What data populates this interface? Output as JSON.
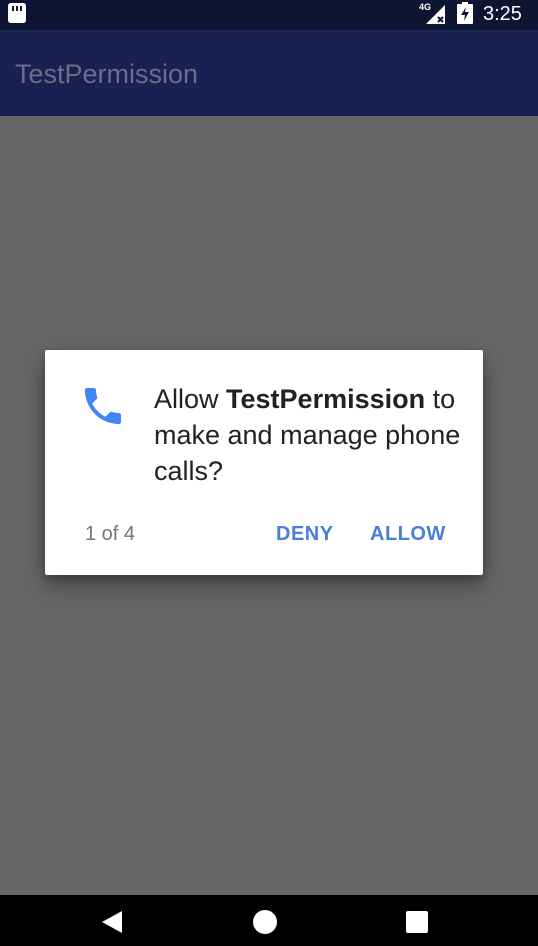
{
  "status_bar": {
    "network_label": "4G",
    "time": "3:25",
    "icons": [
      "sd-card-icon",
      "signal-icon",
      "battery-charging-icon"
    ]
  },
  "app_bar": {
    "title": "TestPermission"
  },
  "dialog": {
    "icon": "phone-icon",
    "message_prefix": "Allow ",
    "app_name": "TestPermission",
    "message_suffix": " to make and manage phone calls?",
    "counter": "1 of 4",
    "deny_label": "DENY",
    "allow_label": "ALLOW"
  },
  "nav_bar": {
    "icons": [
      "back-icon",
      "home-icon",
      "recents-icon"
    ]
  },
  "colors": {
    "status_bar": "#0e1533",
    "app_bar": "#1a2150",
    "scrim": "#666666",
    "accent": "#4a7fd8",
    "phone_icon": "#4285f4"
  }
}
